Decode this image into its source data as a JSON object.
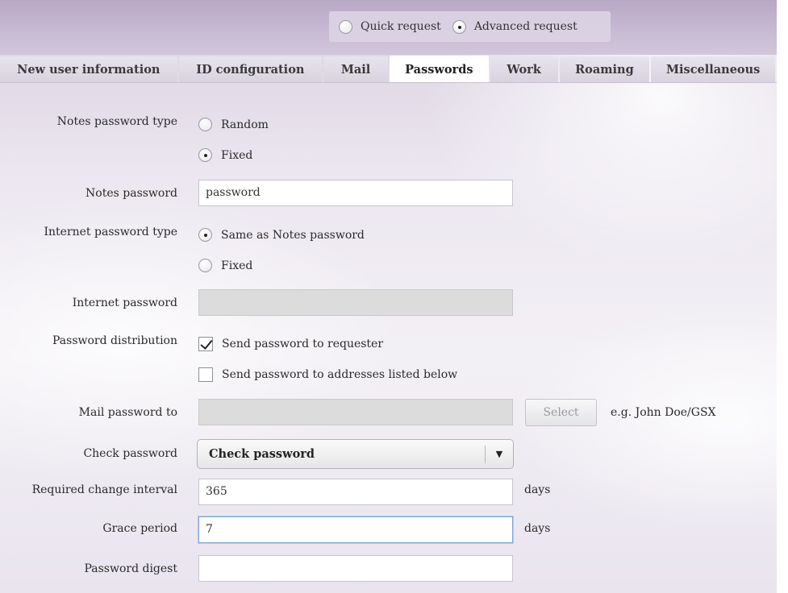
{
  "request_mode": {
    "options": [
      {
        "label": "Quick request",
        "checked": false
      },
      {
        "label": "Advanced request",
        "checked": true
      }
    ]
  },
  "tabs": [
    {
      "label": "New user information",
      "active": false
    },
    {
      "label": "ID configuration",
      "active": false
    },
    {
      "label": "Mail",
      "active": false
    },
    {
      "label": "Passwords",
      "active": true
    },
    {
      "label": "Work",
      "active": false
    },
    {
      "label": "Roaming",
      "active": false
    },
    {
      "label": "Miscellaneous",
      "active": false
    }
  ],
  "form": {
    "notes_password_type": {
      "label": "Notes password type",
      "options": [
        {
          "label": "Random",
          "checked": false
        },
        {
          "label": "Fixed",
          "checked": true
        }
      ]
    },
    "notes_password": {
      "label": "Notes password",
      "value": "password"
    },
    "internet_password_type": {
      "label": "Internet password type",
      "options": [
        {
          "label": "Same as Notes password",
          "checked": true
        },
        {
          "label": "Fixed",
          "checked": false
        }
      ]
    },
    "internet_password": {
      "label": "Internet password",
      "value": "",
      "disabled": true
    },
    "password_distribution": {
      "label": "Password distribution",
      "options": [
        {
          "label": "Send password to requester",
          "checked": true
        },
        {
          "label": "Send password to addresses listed below",
          "checked": false
        }
      ]
    },
    "mail_password_to": {
      "label": "Mail password to",
      "value": "",
      "disabled": true,
      "select_button": "Select",
      "hint": "e.g. John Doe/GSX"
    },
    "check_password": {
      "label": "Check password",
      "value": "Check password"
    },
    "required_change_interval": {
      "label": "Required change interval",
      "value": "365",
      "unit": "days"
    },
    "grace_period": {
      "label": "Grace period",
      "value": "7",
      "unit": "days"
    },
    "password_digest": {
      "label": "Password digest",
      "value": ""
    }
  },
  "colors": {
    "header_band": "#c3b4cf",
    "tab_bg": "#ddd7e3",
    "tab_active": "#ffffff",
    "focus_border": "#7fa6d6",
    "disabled_field": "#dcdcdc"
  },
  "icons": {
    "dropdown_arrow": "triangle-down-icon",
    "checkbox_check": "checkmark-icon"
  }
}
